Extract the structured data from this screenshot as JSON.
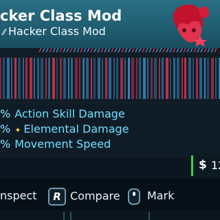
{
  "item": {
    "title": "cker Class Mod",
    "subtitle": "Hacker Class Mod",
    "subtitle_icon": "class-mod-glyph"
  },
  "stats": [
    {
      "pct": "%",
      "label": "Action Skill Damage",
      "icon": ""
    },
    {
      "pct": "%",
      "label": "Elemental Damage",
      "icon": "elemental-icon"
    },
    {
      "pct": "%",
      "label": "Movement Speed",
      "icon": ""
    }
  ],
  "price": {
    "symbol": "$",
    "value": "12"
  },
  "actions": [
    {
      "label": "nspect"
    },
    {
      "key": "R",
      "label": "Compare"
    },
    {
      "label": "Mark",
      "icon": "mouse-icon"
    }
  ],
  "colors": {
    "rarity_red": "#d4324a",
    "rarity_blue": "#3e8ec4",
    "stat_text": "#6fe0ff",
    "price_accent": "#3ad44a"
  }
}
